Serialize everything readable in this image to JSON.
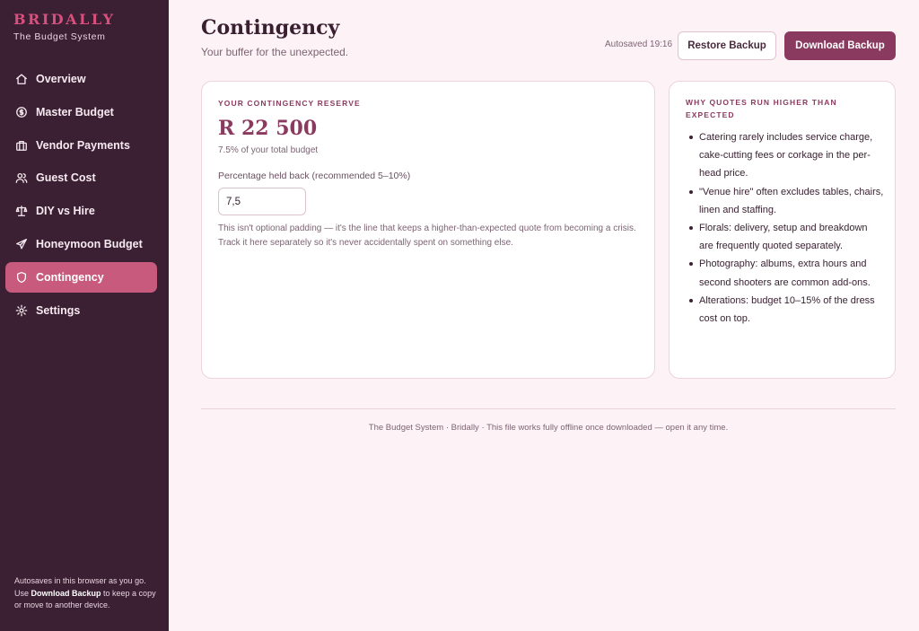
{
  "brand": {
    "name": "BRIDALLY",
    "subtitle": "The Budget System"
  },
  "sidebar": {
    "items": [
      {
        "label": "Overview",
        "icon": "home-icon"
      },
      {
        "label": "Master Budget",
        "icon": "coin-icon"
      },
      {
        "label": "Vendor Payments",
        "icon": "briefcase-icon"
      },
      {
        "label": "Guest Cost",
        "icon": "users-icon"
      },
      {
        "label": "DIY vs Hire",
        "icon": "scale-icon"
      },
      {
        "label": "Honeymoon Budget",
        "icon": "plane-icon"
      },
      {
        "label": "Contingency",
        "icon": "shield-icon",
        "active": true
      },
      {
        "label": "Settings",
        "icon": "gear-icon"
      }
    ],
    "footer": {
      "line1": "Autosaves in this browser as you go.",
      "line2_prefix": "Use ",
      "line2_bold": "Download Backup",
      "line2_suffix": " to keep a copy or move to another device."
    }
  },
  "header": {
    "title": "Contingency",
    "subtitle": "Your buffer for the unexpected.",
    "autosave": "Autosaved 19:16",
    "restore_label": "Restore Backup",
    "download_label": "Download Backup"
  },
  "reserve": {
    "label": "Your contingency reserve",
    "amount": "R 22 500",
    "note": "7.5% of your total budget",
    "field_label": "Percentage held back (recommended 5–10%)",
    "field_value": "7,5",
    "description": "This isn't optional padding — it's the line that keeps a higher-than-expected quote from becoming a crisis. Track it here separately so it's never accidentally spent on something else."
  },
  "tips": {
    "label": "Why quotes run higher than expected",
    "items": [
      "Catering rarely includes service charge, cake-cutting fees or corkage in the per-head price.",
      "\"Venue hire\" often excludes tables, chairs, linen and staffing.",
      "Florals: delivery, setup and breakdown are frequently quoted separately.",
      "Photography: albums, extra hours and second shooters are common add-ons.",
      "Alterations: budget 10–15% of the dress cost on top."
    ]
  },
  "footer": {
    "text": "The Budget System · Bridally · This file works fully offline once downloaded — open it any time."
  },
  "colors": {
    "sidebar_bg": "#3b1f33",
    "accent": "#8a3a5f",
    "active_nav": "#c75a7d",
    "brand": "#d94f7e",
    "page_bg": "#fdf3f6"
  }
}
